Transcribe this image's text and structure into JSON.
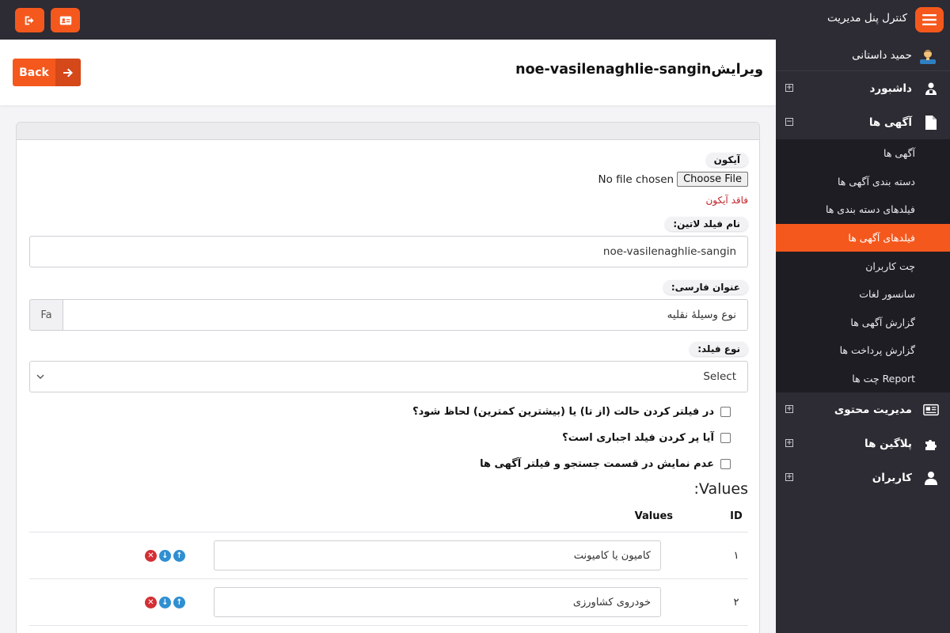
{
  "topbar": {
    "title": "کنترل پنل مدیریت",
    "buttons": [
      "logout-icon",
      "id-card-icon"
    ],
    "accent": "#f5581d",
    "background": "#2d2b33"
  },
  "sidebar": {
    "user_name": "حمید داستانی",
    "menu": [
      {
        "label": "داشبورد",
        "icon": "dashboard-icon",
        "toggle": "+"
      },
      {
        "label": "آگهی ها",
        "icon": "file-icon",
        "toggle": "−"
      }
    ],
    "submenu": [
      {
        "label": "آگهی ها"
      },
      {
        "label": "دسته بندی آگهی ها"
      },
      {
        "label": "فیلدهای دسته بندی ها"
      },
      {
        "label": "فیلدهای آگهی ها",
        "active": true
      },
      {
        "label": "چت کاربران"
      },
      {
        "label": "سانسور لغات"
      },
      {
        "label": "گزارش آگهی ها"
      },
      {
        "label": "گزارش پرداخت ها"
      },
      {
        "label": "Report چت ها"
      }
    ],
    "menu_after": [
      {
        "label": "مدیریت محتوی",
        "icon": "newspaper-icon",
        "toggle": "+"
      },
      {
        "label": "پلاگین ها",
        "icon": "puzzle-icon",
        "toggle": "+"
      },
      {
        "label": "کاربران",
        "icon": "user-icon",
        "toggle": "+"
      }
    ]
  },
  "header": {
    "title": "ویرایشnoe-vasilenaghlie-sangin",
    "back_label": "Back"
  },
  "form": {
    "icon_label": "آیکون",
    "file_status": "No file chosen",
    "file_button": "Choose File",
    "no_icon": "فاقد آیکون",
    "latin_label": "نام فیلد لاتین:",
    "latin_value": "noe-vasilenaghlie-sangin",
    "persian_label": "عنوان فارسی:",
    "persian_value": "نوع وسیلهٔ نقلیه",
    "lang_addon": "Fa",
    "type_label": "نوع فیلد:",
    "type_value": "Select",
    "checkboxes": [
      "در فیلتر کردن حالت (از تا) یا (بیشترین کمترین) لحاظ شود؟",
      "آیا پر کردن فیلد اجباری است؟",
      "عدم نمایش در قسمت جستجو و فیلتر آگهی ها"
    ],
    "values_title": "Values:",
    "table": {
      "headers": {
        "id": "ID",
        "values": "Values"
      },
      "rows": [
        {
          "id": "۱",
          "value": "کامیون یا کامیونت"
        },
        {
          "id": "۲",
          "value": "خودروی کشاورزی"
        }
      ]
    }
  }
}
